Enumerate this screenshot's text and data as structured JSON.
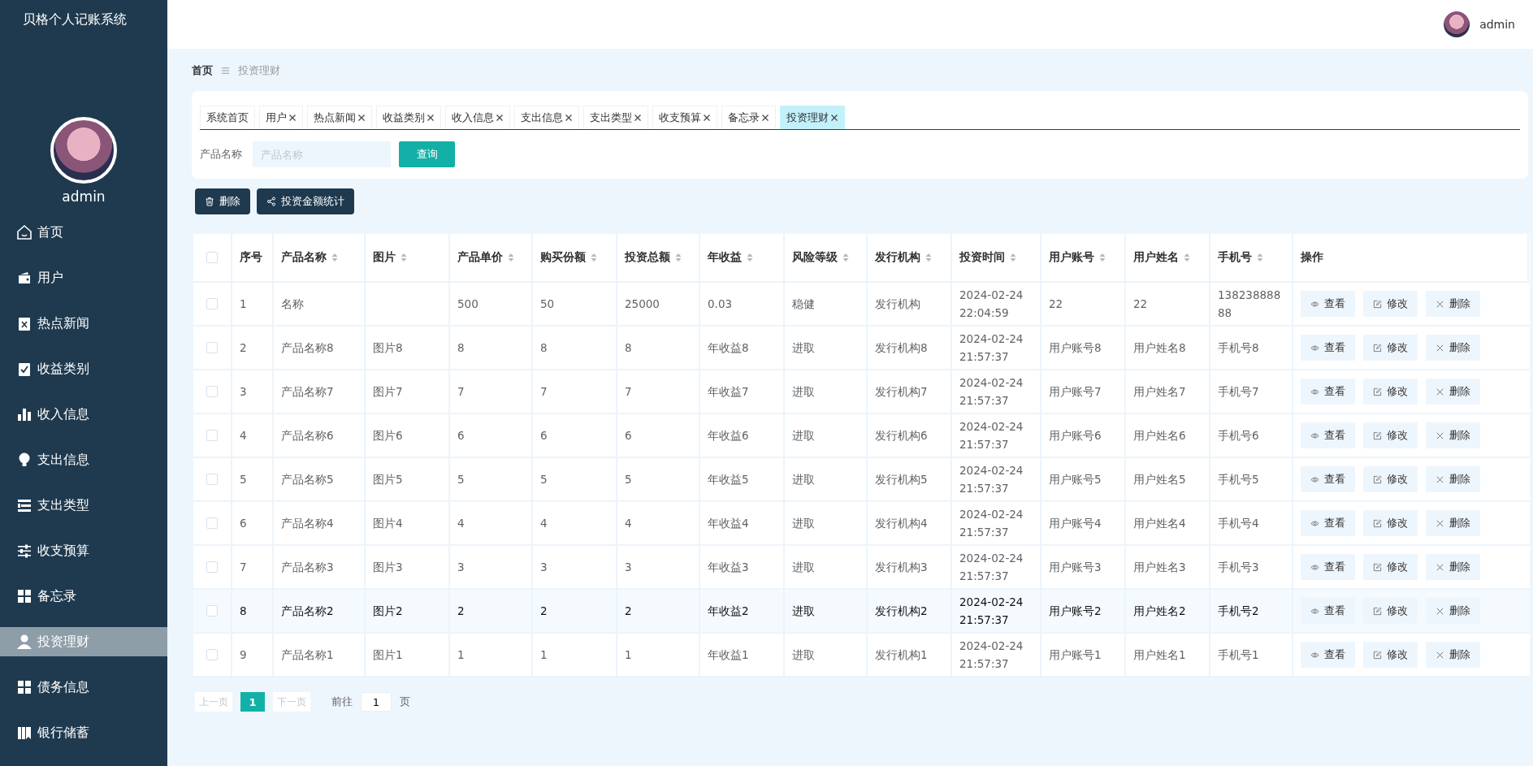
{
  "app_title": "贝格个人记账系统",
  "sidebar": {
    "username": "admin",
    "items": [
      {
        "label": "首页",
        "selected": false
      },
      {
        "label": "用户",
        "selected": false
      },
      {
        "label": "热点新闻",
        "selected": false
      },
      {
        "label": "收益类别",
        "selected": false
      },
      {
        "label": "收入信息",
        "selected": false
      },
      {
        "label": "支出信息",
        "selected": false
      },
      {
        "label": "支出类型",
        "selected": false
      },
      {
        "label": "收支预算",
        "selected": false
      },
      {
        "label": "备忘录",
        "selected": false
      },
      {
        "label": "投资理财",
        "selected": true
      },
      {
        "label": "债务信息",
        "selected": false
      },
      {
        "label": "银行储蓄",
        "selected": false
      }
    ]
  },
  "topbar": {
    "username": "admin"
  },
  "breadcrumb": [
    "首页",
    "投资理财"
  ],
  "tabs": [
    {
      "label": "系统首页",
      "closable": false,
      "selected": false
    },
    {
      "label": "用户",
      "closable": true,
      "selected": false
    },
    {
      "label": "热点新闻",
      "closable": true,
      "selected": false
    },
    {
      "label": "收益类别",
      "closable": true,
      "selected": false
    },
    {
      "label": "收入信息",
      "closable": true,
      "selected": false
    },
    {
      "label": "支出信息",
      "closable": true,
      "selected": false
    },
    {
      "label": "支出类型",
      "closable": true,
      "selected": false
    },
    {
      "label": "收支预算",
      "closable": true,
      "selected": false
    },
    {
      "label": "备忘录",
      "closable": true,
      "selected": false
    },
    {
      "label": "投资理财",
      "closable": true,
      "selected": true
    }
  ],
  "search": {
    "label": "产品名称",
    "placeholder": "产品名称",
    "button": "查询"
  },
  "actions": [
    {
      "kind": "delete",
      "label": "删除"
    },
    {
      "kind": "stats",
      "label": "投资金额统计"
    }
  ],
  "table": {
    "header_checked": false,
    "columns": [
      {
        "label": "序号",
        "sortable": false
      },
      {
        "label": "产品名称",
        "sortable": true
      },
      {
        "label": "图片",
        "sortable": true
      },
      {
        "label": "产品单价",
        "sortable": true
      },
      {
        "label": "购买份额",
        "sortable": true
      },
      {
        "label": "投资总额",
        "sortable": true
      },
      {
        "label": "年收益",
        "sortable": true
      },
      {
        "label": "风险等级",
        "sortable": true
      },
      {
        "label": "发行机构",
        "sortable": true
      },
      {
        "label": "投资时间",
        "sortable": true
      },
      {
        "label": "用户账号",
        "sortable": true
      },
      {
        "label": "用户姓名",
        "sortable": true
      },
      {
        "label": "手机号",
        "sortable": true
      },
      {
        "label": "操作",
        "sortable": false
      }
    ],
    "rows": [
      {
        "checked": false,
        "hovered": false,
        "cells": [
          "1",
          "名称",
          "",
          "500",
          "50",
          "25000",
          "0.03",
          "稳健",
          "发行机构",
          "2024-02-24 22:04:59",
          "22",
          "22",
          "13823888888"
        ],
        "actions": [
          {
            "kind": "view",
            "label": "查看"
          },
          {
            "kind": "edit",
            "label": "修改"
          },
          {
            "kind": "delete",
            "label": "删除"
          }
        ]
      },
      {
        "checked": false,
        "hovered": false,
        "cells": [
          "2",
          "产品名称8",
          "图片8",
          "8",
          "8",
          "8",
          "年收益8",
          "进取",
          "发行机构8",
          "2024-02-24 21:57:37",
          "用户账号8",
          "用户姓名8",
          "手机号8"
        ],
        "actions": [
          {
            "kind": "view",
            "label": "查看"
          },
          {
            "kind": "edit",
            "label": "修改"
          },
          {
            "kind": "delete",
            "label": "删除"
          }
        ]
      },
      {
        "checked": false,
        "hovered": false,
        "cells": [
          "3",
          "产品名称7",
          "图片7",
          "7",
          "7",
          "7",
          "年收益7",
          "进取",
          "发行机构7",
          "2024-02-24 21:57:37",
          "用户账号7",
          "用户姓名7",
          "手机号7"
        ],
        "actions": [
          {
            "kind": "view",
            "label": "查看"
          },
          {
            "kind": "edit",
            "label": "修改"
          },
          {
            "kind": "delete",
            "label": "删除"
          }
        ]
      },
      {
        "checked": false,
        "hovered": false,
        "cells": [
          "4",
          "产品名称6",
          "图片6",
          "6",
          "6",
          "6",
          "年收益6",
          "进取",
          "发行机构6",
          "2024-02-24 21:57:37",
          "用户账号6",
          "用户姓名6",
          "手机号6"
        ],
        "actions": [
          {
            "kind": "view",
            "label": "查看"
          },
          {
            "kind": "edit",
            "label": "修改"
          },
          {
            "kind": "delete",
            "label": "删除"
          }
        ]
      },
      {
        "checked": false,
        "hovered": false,
        "cells": [
          "5",
          "产品名称5",
          "图片5",
          "5",
          "5",
          "5",
          "年收益5",
          "进取",
          "发行机构5",
          "2024-02-24 21:57:37",
          "用户账号5",
          "用户姓名5",
          "手机号5"
        ],
        "actions": [
          {
            "kind": "view",
            "label": "查看"
          },
          {
            "kind": "edit",
            "label": "修改"
          },
          {
            "kind": "delete",
            "label": "删除"
          }
        ]
      },
      {
        "checked": false,
        "hovered": false,
        "cells": [
          "6",
          "产品名称4",
          "图片4",
          "4",
          "4",
          "4",
          "年收益4",
          "进取",
          "发行机构4",
          "2024-02-24 21:57:37",
          "用户账号4",
          "用户姓名4",
          "手机号4"
        ],
        "actions": [
          {
            "kind": "view",
            "label": "查看"
          },
          {
            "kind": "edit",
            "label": "修改"
          },
          {
            "kind": "delete",
            "label": "删除"
          }
        ]
      },
      {
        "checked": false,
        "hovered": false,
        "cells": [
          "7",
          "产品名称3",
          "图片3",
          "3",
          "3",
          "3",
          "年收益3",
          "进取",
          "发行机构3",
          "2024-02-24 21:57:37",
          "用户账号3",
          "用户姓名3",
          "手机号3"
        ],
        "actions": [
          {
            "kind": "view",
            "label": "查看"
          },
          {
            "kind": "edit",
            "label": "修改"
          },
          {
            "kind": "delete",
            "label": "删除"
          }
        ]
      },
      {
        "checked": false,
        "hovered": true,
        "cells": [
          "8",
          "产品名称2",
          "图片2",
          "2",
          "2",
          "2",
          "年收益2",
          "进取",
          "发行机构2",
          "2024-02-24 21:57:37",
          "用户账号2",
          "用户姓名2",
          "手机号2"
        ],
        "actions": [
          {
            "kind": "view",
            "label": "查看"
          },
          {
            "kind": "edit",
            "label": "修改"
          },
          {
            "kind": "delete",
            "label": "删除"
          }
        ]
      },
      {
        "checked": false,
        "hovered": false,
        "cells": [
          "9",
          "产品名称1",
          "图片1",
          "1",
          "1",
          "1",
          "年收益1",
          "进取",
          "发行机构1",
          "2024-02-24 21:57:37",
          "用户账号1",
          "用户姓名1",
          "手机号1"
        ],
        "actions": [
          {
            "kind": "view",
            "label": "查看"
          },
          {
            "kind": "edit",
            "label": "修改"
          },
          {
            "kind": "delete",
            "label": "删除"
          }
        ]
      }
    ]
  },
  "pagination": {
    "prev": {
      "label": "上一页",
      "disabled": true
    },
    "pages": [
      {
        "label": "1",
        "selected": true
      }
    ],
    "next": {
      "label": "下一页",
      "disabled": true
    },
    "goto_label": "前往",
    "goto_value": "1",
    "goto_suffix": "页"
  }
}
